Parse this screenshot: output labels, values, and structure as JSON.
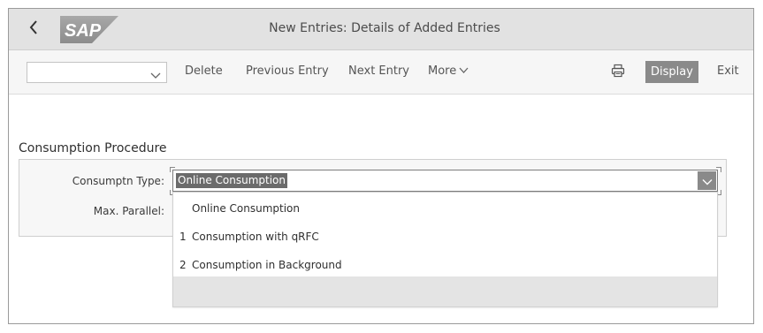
{
  "shell": {
    "title": "New Entries: Details of Added Entries",
    "logo_text": "SAP"
  },
  "toolbar": {
    "select_value": "",
    "delete_label": "Delete",
    "previous_label": "Previous Entry",
    "next_label": "Next Entry",
    "more_label": "More",
    "display_label": "Display",
    "exit_label": "Exit"
  },
  "section": {
    "title": "Consumption Procedure",
    "fields": {
      "consumption_type_label": "Consumptn Type:",
      "consumption_type_value": "Online Consumption",
      "max_parallel_label": "Max. Parallel:"
    }
  },
  "dropdown": {
    "options": [
      {
        "key": "",
        "label": "Online Consumption"
      },
      {
        "key": "1",
        "label": "Consumption with qRFC"
      },
      {
        "key": "2",
        "label": "Consumption in Background"
      }
    ]
  },
  "colors": {
    "shell_bg": "#e2e2e2",
    "toolbar_bg": "#f6f6f6",
    "display_button_bg": "#8a8a8a",
    "selection_bg": "#6b6b6b"
  },
  "icons": [
    "back-icon",
    "chevron-down-icon",
    "print-icon"
  ]
}
